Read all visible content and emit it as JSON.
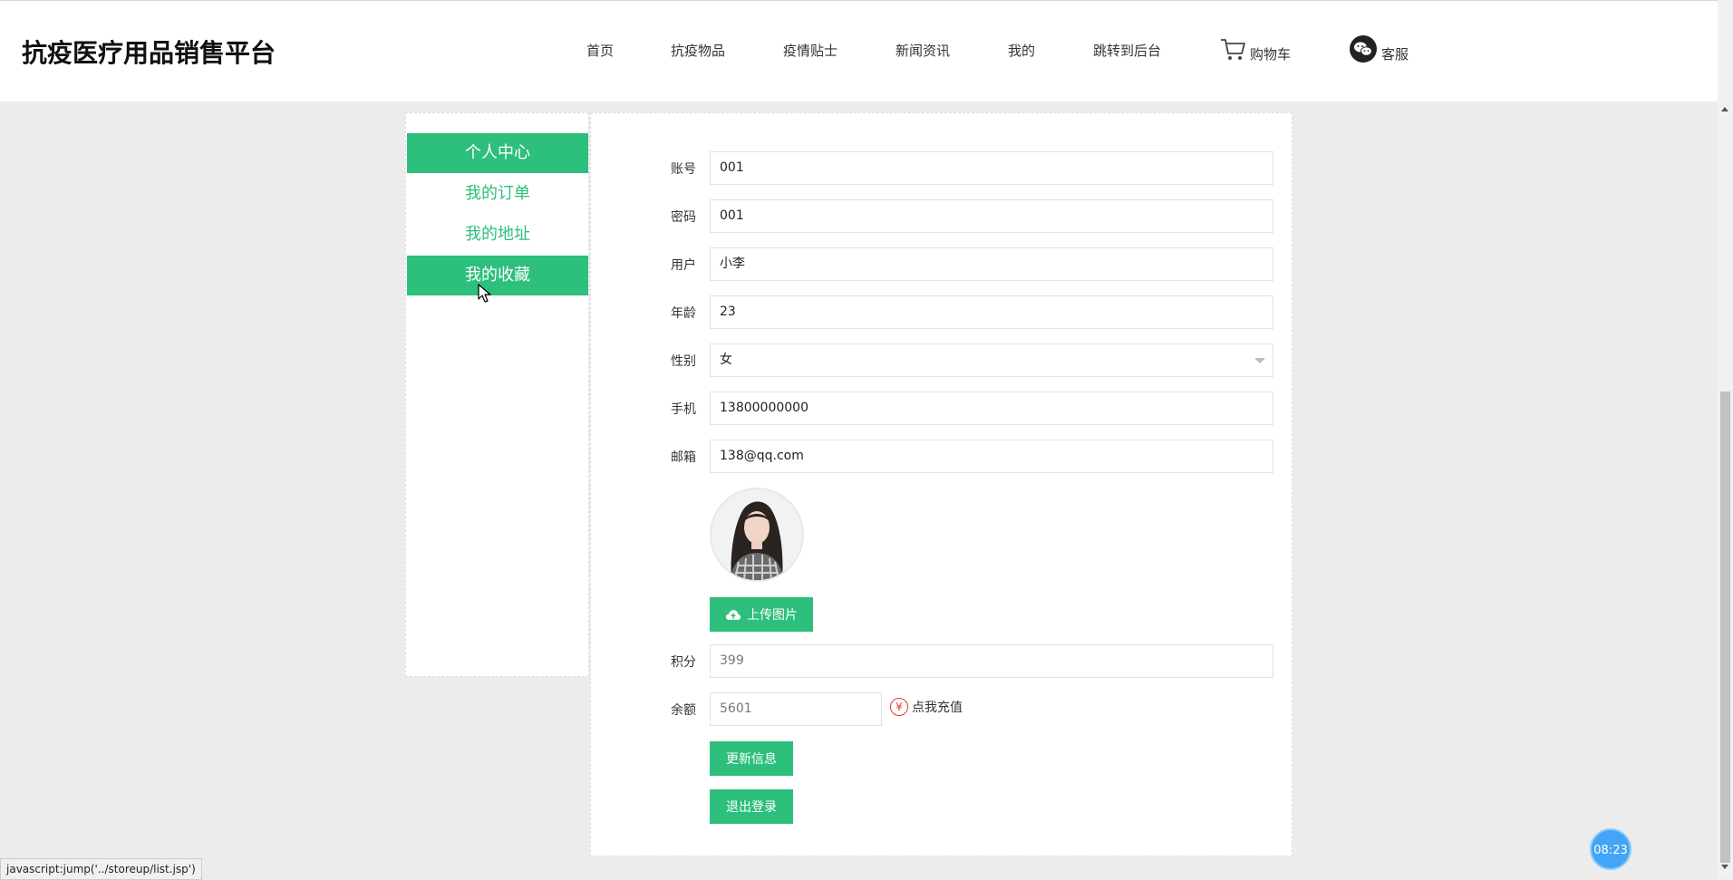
{
  "brand": "抗疫医疗用品销售平台",
  "nav": {
    "home": "首页",
    "goods": "抗疫物品",
    "tips": "疫情贴士",
    "news": "新闻资讯",
    "mine": "我的",
    "admin": "跳转到后台",
    "cart": "购物车",
    "service": "客服"
  },
  "sidebar": {
    "items": [
      {
        "label": "个人中心",
        "active": true
      },
      {
        "label": "我的订单",
        "active": false
      },
      {
        "label": "我的地址",
        "active": false
      },
      {
        "label": "我的收藏",
        "active": true
      }
    ]
  },
  "form": {
    "account": {
      "label": "账号",
      "value": "001"
    },
    "password": {
      "label": "密码",
      "value": "001"
    },
    "username": {
      "label": "用户",
      "value": "小李"
    },
    "age": {
      "label": "年龄",
      "value": "23"
    },
    "gender": {
      "label": "性别",
      "value": "女"
    },
    "phone": {
      "label": "手机",
      "value": "13800000000"
    },
    "email": {
      "label": "邮箱",
      "value": "138@qq.com"
    },
    "upload_label": "上传图片",
    "points": {
      "label": "积分",
      "value": "399"
    },
    "balance": {
      "label": "余额",
      "value": "5601"
    },
    "recharge_label": "点我充值",
    "recharge_symbol": "¥",
    "update_label": "更新信息",
    "logout_label": "退出登录"
  },
  "timer": "08:23",
  "status_bar": "javascript:jump('../storeup/list.jsp')",
  "colors": {
    "accent": "#2dbf7c",
    "recharge": "#e53935",
    "timer": "#42a5f5"
  }
}
